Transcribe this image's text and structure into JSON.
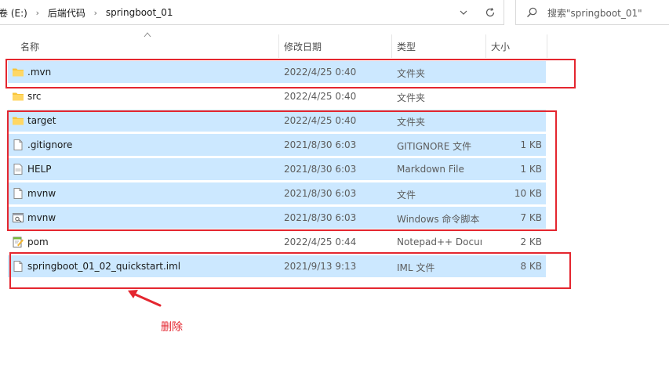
{
  "address_bar": {
    "crumbs": [
      "卷 (E:)",
      "后端代码",
      "springboot_01"
    ],
    "separator": "›"
  },
  "search": {
    "placeholder": "搜索\"springboot_01\""
  },
  "columns": {
    "name": "名称",
    "date": "修改日期",
    "type": "类型",
    "size": "大小"
  },
  "files": [
    {
      "name": ".mvn",
      "date": "2022/4/25 0:40",
      "type": "文件夹",
      "size": "",
      "icon": "folder-icon",
      "selected": true
    },
    {
      "name": "src",
      "date": "2022/4/25 0:40",
      "type": "文件夹",
      "size": "",
      "icon": "folder-icon",
      "selected": false
    },
    {
      "name": "target",
      "date": "2022/4/25 0:40",
      "type": "文件夹",
      "size": "",
      "icon": "folder-icon",
      "selected": true
    },
    {
      "name": ".gitignore",
      "date": "2021/8/30 6:03",
      "type": "GITIGNORE 文件",
      "size": "1 KB",
      "icon": "file-icon",
      "selected": true
    },
    {
      "name": "HELP",
      "date": "2021/8/30 6:03",
      "type": "Markdown File",
      "size": "1 KB",
      "icon": "markdown-file-icon",
      "selected": true
    },
    {
      "name": "mvnw",
      "date": "2021/8/30 6:03",
      "type": "文件",
      "size": "10 KB",
      "icon": "file-icon",
      "selected": true
    },
    {
      "name": "mvnw",
      "date": "2021/8/30 6:03",
      "type": "Windows 命令脚本",
      "size": "7 KB",
      "icon": "script-file-icon",
      "selected": true
    },
    {
      "name": "pom",
      "date": "2022/4/25 0:44",
      "type": "Notepad++ Document",
      "size": "2 KB",
      "icon": "notepad-file-icon",
      "selected": false
    },
    {
      "name": "springboot_01_02_quickstart.iml",
      "date": "2021/9/13 9:13",
      "type": "IML 文件",
      "size": "8 KB",
      "icon": "file-icon",
      "selected": true
    }
  ],
  "annotation": {
    "label": "删除",
    "color": "#e4262f"
  },
  "colors": {
    "selection": "#cce8ff",
    "highlight_box": "#e4262f"
  }
}
